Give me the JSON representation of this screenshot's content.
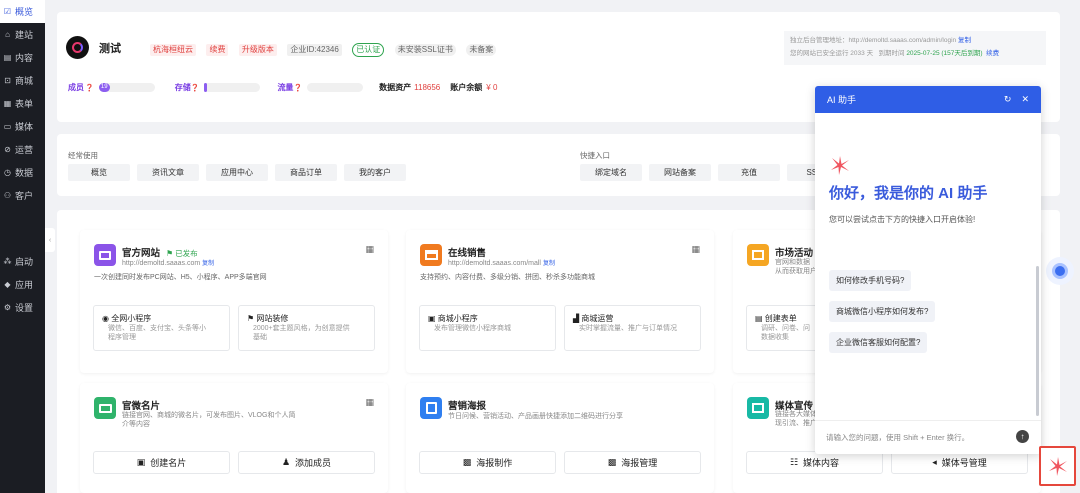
{
  "sidebar": {
    "items": [
      {
        "icon": "☑",
        "label": "概览",
        "active": true
      },
      {
        "icon": "⌂",
        "label": "建站"
      },
      {
        "icon": "▤",
        "label": "内容"
      },
      {
        "icon": "⊡",
        "label": "商城"
      },
      {
        "icon": "▦",
        "label": "表单"
      },
      {
        "icon": "▭",
        "label": "媒体"
      },
      {
        "icon": "⊘",
        "label": "运营"
      },
      {
        "icon": "◷",
        "label": "数据"
      },
      {
        "icon": "⚇",
        "label": "客户"
      }
    ],
    "bottom": [
      {
        "icon": "⁂",
        "label": "启动"
      },
      {
        "icon": "◆",
        "label": "应用"
      },
      {
        "icon": "⚙",
        "label": "设置"
      }
    ]
  },
  "header": {
    "site_name": "测试",
    "tags": [
      "杭海桓纽云",
      "续费",
      "升级版本",
      "企业ID:42346",
      "已认证",
      "未安装SSL证书",
      "未备案"
    ],
    "admin_url_label": "独立后台管理地址：http://demoltd.saaas.com/admin/login",
    "copy": "复制",
    "safe_run": "您的网站已安全运行 2033 天",
    "expire_label": "到期时间",
    "expire_date": "2025-07-25 (157天后到期)",
    "renew": "续费",
    "stats": {
      "members_label": "成员",
      "members_val": "19",
      "storage_label": "存储",
      "traffic_label": "流量",
      "assets_label": "数据资产",
      "assets_val": "118656",
      "balance_label": "账户余额",
      "balance_val": "¥ 0"
    }
  },
  "common": {
    "title": "经常使用",
    "buttons": [
      "概览",
      "资讯文章",
      "应用中心",
      "商品订单",
      "我的客户"
    ]
  },
  "quick": {
    "title": "快捷入口",
    "buttons": [
      "绑定域名",
      "网站备案",
      "充值",
      "SSL证"
    ]
  },
  "services": [
    {
      "title": "官方网站",
      "status": "已发布",
      "url": "http://demoltd.saaas.com",
      "copy": "复制",
      "desc": "一次创建同时发布PC网站、H5、小程序、APP多端官网",
      "subs": [
        {
          "title": "全网小程序",
          "desc": "微信、百度、支付宝、头条等小\n程序管理"
        },
        {
          "title": "网站装修",
          "desc": "2000+套主题风格，为创意提供\n基础"
        }
      ]
    },
    {
      "title": "在线销售",
      "url": "http://demoltd.saaas.com/mall",
      "copy": "复制",
      "desc": "支持预约、内容付费、多级分销、拼团、秒杀多功能商城",
      "subs": [
        {
          "title": "商城小程序",
          "desc": "发布管理微信小程序商城"
        },
        {
          "title": "商城运营",
          "desc": "实时掌握流量、推广与订单情况"
        }
      ]
    },
    {
      "title": "市场活动",
      "desc_l1": "官网和数据",
      "desc_l2": "从而获取用户",
      "subs": [
        {
          "title": "创建表单",
          "desc": "调研、问卷、问\n数据收集"
        }
      ]
    },
    {
      "title": "官微名片",
      "desc": "链接官网、商城的微名片，可发布图片、VLOG和个人简\n介等内容",
      "btns": [
        "创建名片",
        "添加成员"
      ]
    },
    {
      "title": "营销海报",
      "desc": "节日问候、营销活动、产品画册快捷添加二维码进行分享",
      "btns": [
        "海报制作",
        "海报管理"
      ]
    },
    {
      "title": "媒体宣传",
      "desc_l1": "链接各大媒体",
      "desc_l2": "现引流、推广",
      "btns": [
        "媒体内容",
        "媒体号管理"
      ]
    }
  ],
  "chat": {
    "title": "AI 助手",
    "greeting": "你好，我是你的 AI 助手",
    "hint": "您可以尝试点击下方的快捷入口开启体验!",
    "suggestions": [
      "如何修改手机号码?",
      "商城微信小程序如何发布?",
      "企业微信客服如何配置?"
    ],
    "input_placeholder": "请输入您的问题，使用 Shift + Enter 换行。"
  },
  "colors": {
    "accent": "#2f5ee6",
    "sidebar_bg": "#1b1d23"
  }
}
